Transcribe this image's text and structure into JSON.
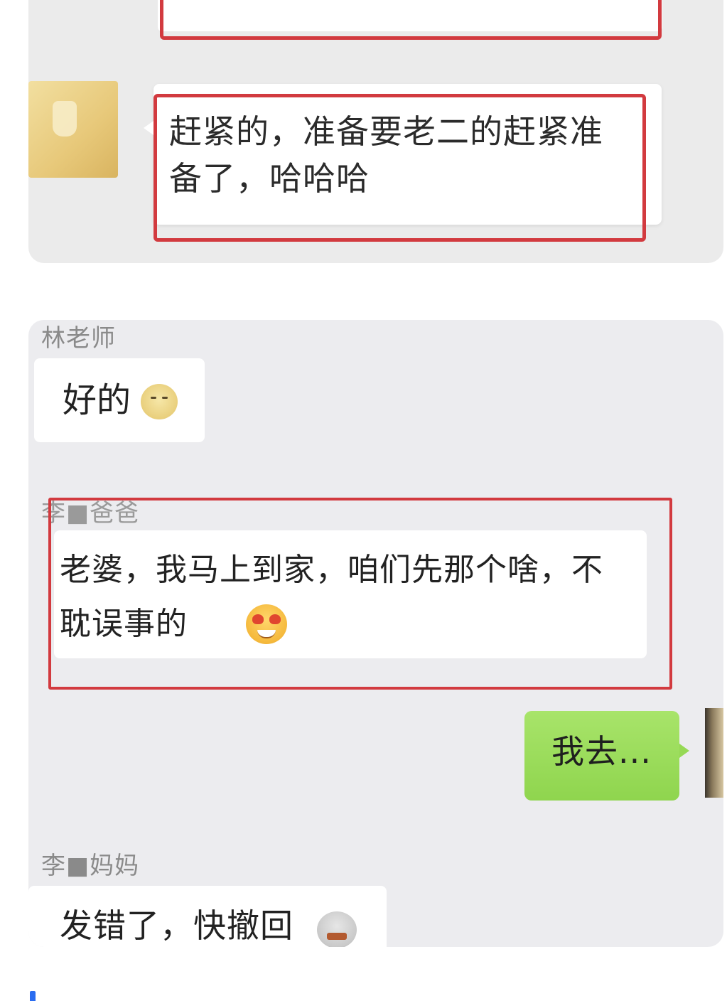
{
  "top_panel": {
    "message_text": "赶紧的，准备要老二的赶紧准备了，哈哈哈"
  },
  "bottom_panel": {
    "messages": [
      {
        "sender": "林老师",
        "text": "好的",
        "emoji": "smirk-face-emoji"
      },
      {
        "sender": "李■爸爸",
        "text": "老婆，我马上到家，咱们先那个啥，不耽误事的",
        "emoji": "heart-eyes-emoji"
      },
      {
        "sender": "",
        "text": "我去...",
        "emoji": ""
      },
      {
        "sender": "李■妈妈",
        "text": "发错了，快撤回",
        "emoji": "angry-face-emoji"
      }
    ]
  },
  "colors": {
    "highlight_red": "#d23a3f",
    "outgoing_green": "#96d955",
    "panel_bg": "#ececef"
  }
}
